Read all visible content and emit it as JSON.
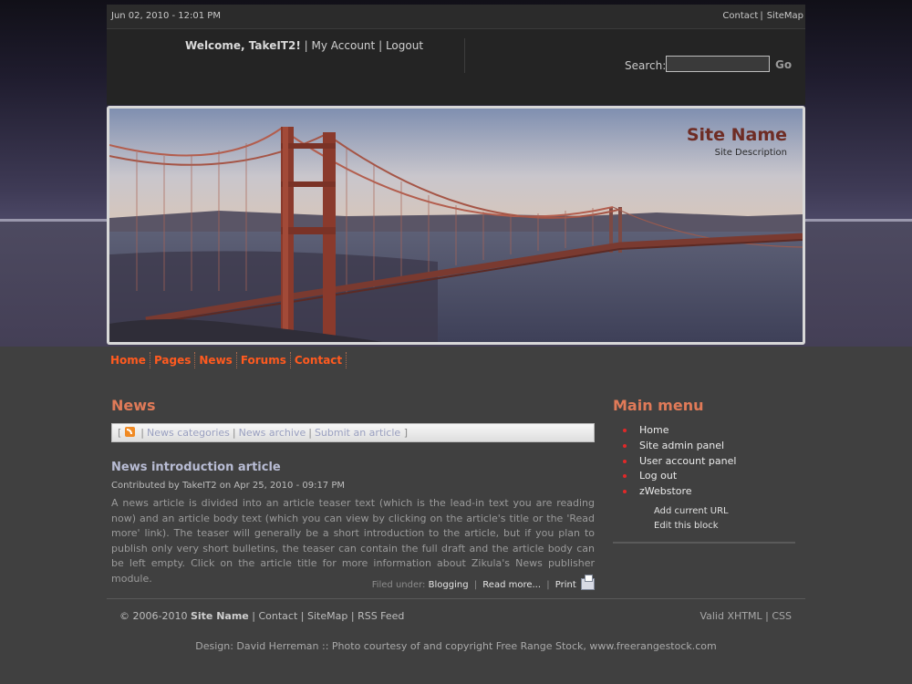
{
  "topbar": {
    "date": "Jun 02, 2010 - 12:01 PM",
    "contact": "Contact",
    "sitemap": "SiteMap"
  },
  "userbar": {
    "welcome": "Welcome, TakeIT2!",
    "my_account": "My Account",
    "logout": "Logout"
  },
  "search": {
    "label": "Search:",
    "value": "",
    "go": "Go"
  },
  "banner": {
    "site_name": "Site Name",
    "site_description": "Site Description"
  },
  "nav": [
    "Home",
    "Pages",
    "News",
    "Forums",
    "Contact"
  ],
  "news": {
    "heading": "News",
    "bar": {
      "categories": "News categories",
      "archive": "News archive",
      "submit": "Submit an article"
    },
    "article": {
      "title": "News introduction article",
      "meta": "Contributed by TakeIT2 on Apr 25, 2010 - 09:17 PM",
      "body": "A news article is divided into an article teaser text (which is the lead-in text you are reading now) and an article body text (which you can view by clicking on the article's title or the 'Read more' link). The teaser will generally be a short introduction to the article, but if you plan to publish only very short bulletins, the teaser can contain the full draft and the article body can be left empty. Click on the article title for more information about Zikula's News publisher module.",
      "filed_under_label": "Filed under:",
      "category": "Blogging",
      "read_more": "Read more...",
      "print": "Print"
    }
  },
  "main_menu": {
    "heading": "Main menu",
    "items": [
      "Home",
      "Site admin panel",
      "User account panel",
      "Log out",
      "zWebstore"
    ],
    "add_current_url": "Add current URL",
    "edit_block": "Edit this block"
  },
  "footer": {
    "copyright": "© 2006-2010",
    "site_name": "Site Name",
    "contact": "Contact",
    "sitemap": "SiteMap",
    "rss": "RSS Feed",
    "valid_xhtml": "Valid XHTML",
    "css": "CSS",
    "credits": "Design: David Herreman :: Photo courtesy of and copyright Free Range Stock, www.freerangestock.com"
  },
  "colors": {
    "accent_orange": "#ff5a1f",
    "heading_salmon": "#e07a58",
    "site_name_red": "#6e2c24",
    "bullet_red": "#e02828"
  }
}
